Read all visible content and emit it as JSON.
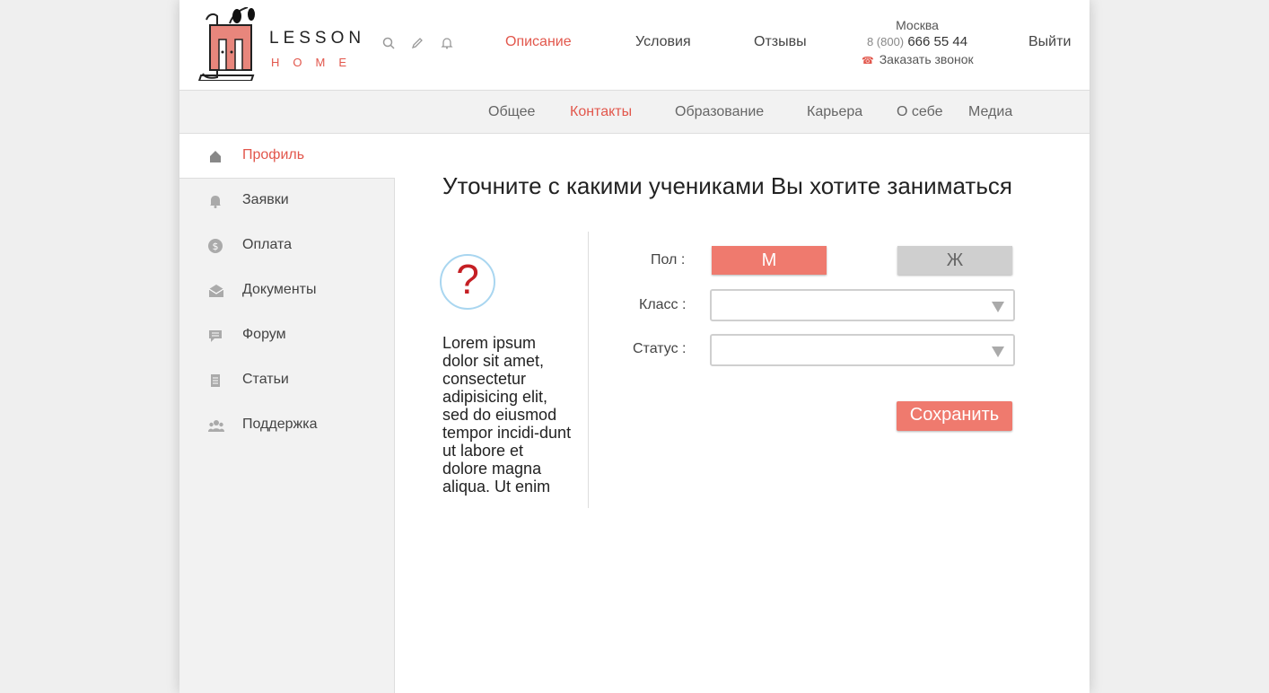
{
  "brand": {
    "word": "LESSON",
    "sub": "HOME"
  },
  "header_icons": [
    "search-icon",
    "pencil-icon",
    "bell-icon"
  ],
  "nav": [
    {
      "label": "Описание",
      "active": true
    },
    {
      "label": "Условия",
      "active": false
    },
    {
      "label": "Отзывы",
      "active": false
    }
  ],
  "contact": {
    "city": "Москва",
    "phone_code": "8 (800)",
    "phone_number": "666 55 44",
    "callback_icon": "phone-icon",
    "callback": "Заказать звонок"
  },
  "logout": "Выйти",
  "subnav": [
    {
      "label": "Общее",
      "active": false
    },
    {
      "label": "Контакты",
      "active": true
    },
    {
      "label": "Образование",
      "active": false
    },
    {
      "label": "Карьера",
      "active": false
    },
    {
      "label": "О себе",
      "active": false
    },
    {
      "label": "Медиа",
      "active": false
    }
  ],
  "sidebar": [
    {
      "label": "Профиль",
      "icon": "home-icon",
      "active": true
    },
    {
      "label": "Заявки",
      "icon": "bell-icon",
      "active": false
    },
    {
      "label": "Оплата",
      "icon": "dollar-icon",
      "active": false
    },
    {
      "label": "Документы",
      "icon": "envelope-icon",
      "active": false
    },
    {
      "label": "Форум",
      "icon": "chat-icon",
      "active": false
    },
    {
      "label": "Статьи",
      "icon": "article-icon",
      "active": false
    },
    {
      "label": "Поддержка",
      "icon": "users-icon",
      "active": false
    }
  ],
  "main": {
    "title": "Уточните с какими учениками Вы хотите заниматься",
    "help_symbol": "?",
    "help_text": "Lorem ipsum dolor sit amet, consectetur adipisicing elit, sed do eiusmod tempor incidi-dunt ut labore et dolore magna aliqua. Ut enim",
    "gender_label": "Пол :",
    "gender_male": "М",
    "gender_female": "Ж",
    "class_label": "Класс :",
    "class_value": "",
    "status_label": "Статус :",
    "status_value": "",
    "save": "Сохранить"
  },
  "colors": {
    "accent": "#e2574c",
    "button": "#ef7a6e",
    "inactive_button": "#cfcfcf",
    "sidebar_bg": "#f2f2f2"
  }
}
